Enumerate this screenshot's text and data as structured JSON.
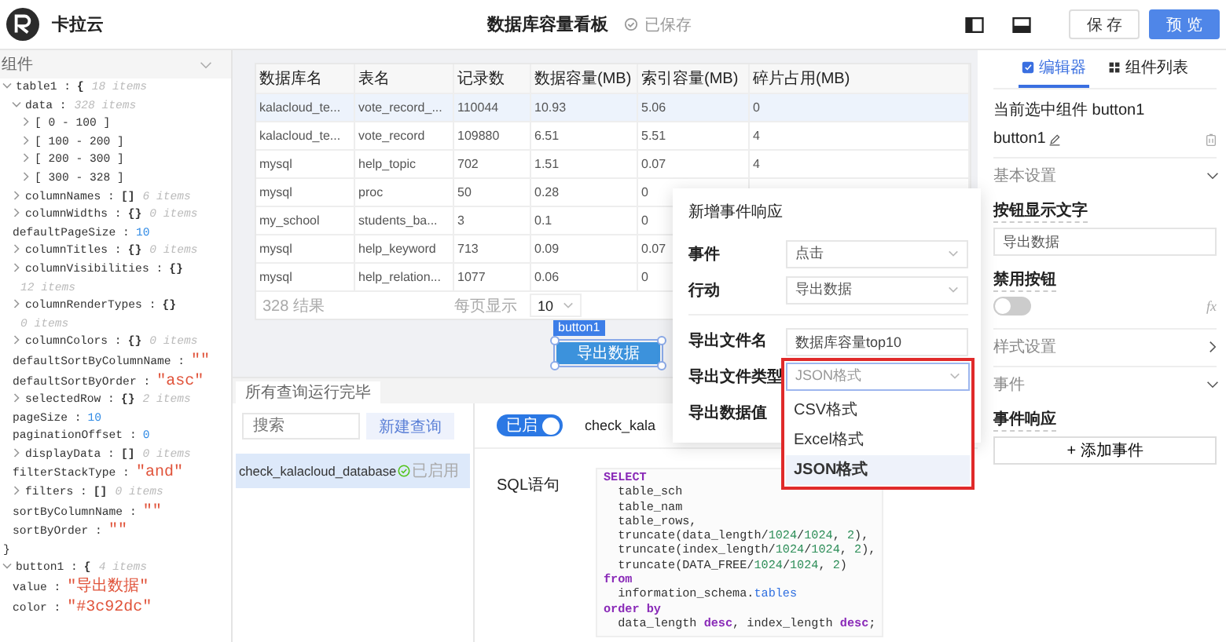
{
  "app": {
    "name": "卡拉云"
  },
  "header": {
    "title": "数据库容量看板",
    "save_status": "已保存",
    "buttons": [
      {
        "label": "保 存",
        "kind": "default"
      },
      {
        "label": "预 览",
        "kind": "primary"
      }
    ]
  },
  "state_panel": {
    "title": "组件",
    "tree": [
      {
        "key": "table1 :",
        "value": "{",
        "kind": "brace",
        "count": "18 items",
        "expanded": true,
        "close": "}",
        "children": [
          {
            "key": "data :",
            "count": "328 items",
            "expanded": true,
            "children": [
              {
                "key": "[ 0 - 100 ]",
                "expanded": false
              },
              {
                "key": "[ 100 - 200 ]",
                "expanded": false
              },
              {
                "key": "[ 200 - 300 ]",
                "expanded": false
              },
              {
                "key": "[ 300 - 328 ]",
                "expanded": false
              }
            ]
          },
          {
            "key": "columnNames :",
            "value": "[]",
            "kind": "brace",
            "count": "6 items",
            "expanded": false
          },
          {
            "key": "columnWidths :",
            "value": "{}",
            "kind": "brace",
            "count": "0 items",
            "expanded": false
          },
          {
            "key": "defaultPageSize :",
            "value": "10",
            "kind": "number"
          },
          {
            "key": "columnTitles :",
            "value": "{}",
            "kind": "brace",
            "count": "0 items",
            "expanded": false
          },
          {
            "key": "columnVisibilities :",
            "value": "{}",
            "kind": "brace",
            "count": "12 items",
            "expanded": false
          },
          {
            "key": "columnRenderTypes :",
            "value": "{}",
            "kind": "brace",
            "count": "0 items",
            "expanded": false
          },
          {
            "key": "columnColors :",
            "value": "{}",
            "kind": "brace",
            "count": "0 items",
            "expanded": false
          },
          {
            "key": "defaultSortByColumnName :",
            "value": "\"\"",
            "kind": "string"
          },
          {
            "key": "defaultSortByOrder :",
            "value": "\"asc\"",
            "kind": "string"
          },
          {
            "key": "selectedRow :",
            "value": "{}",
            "kind": "brace",
            "count": "2 items",
            "expanded": false
          },
          {
            "key": "pageSize :",
            "value": "10",
            "kind": "number"
          },
          {
            "key": "paginationOffset :",
            "value": "0",
            "kind": "number"
          },
          {
            "key": "displayData :",
            "value": "[]",
            "kind": "brace",
            "count": "0 items",
            "expanded": false
          },
          {
            "key": "filterStackType :",
            "value": "\"and\"",
            "kind": "string"
          },
          {
            "key": "filters :",
            "value": "[]",
            "kind": "brace",
            "count": "0 items",
            "expanded": false
          },
          {
            "key": "sortByColumnName :",
            "value": "\"\"",
            "kind": "string"
          },
          {
            "key": "sortByOrder :",
            "value": "\"\"",
            "kind": "string"
          }
        ]
      },
      {
        "key": "button1 :",
        "value": "{",
        "kind": "brace",
        "count": "4 items",
        "expanded": true,
        "children": [
          {
            "key": "value :",
            "value": "\"导出数据\"",
            "kind": "string"
          },
          {
            "key": "color :",
            "value": "\"#3c92dc\"",
            "kind": "string"
          }
        ]
      }
    ]
  },
  "table": {
    "columns": [
      "数据库名",
      "表名",
      "记录数",
      "数据容量(MB)",
      "索引容量(MB)",
      "碎片占用(MB)"
    ],
    "rows": [
      {
        "cells": [
          "kalacloud_te...",
          "vote_record_...",
          "110044",
          "10.93",
          "5.06",
          "0"
        ],
        "selected": true
      },
      {
        "cells": [
          "kalacloud_te...",
          "vote_record",
          "109880",
          "6.51",
          "5.51",
          "4"
        ],
        "selected": false
      },
      {
        "cells": [
          "mysql",
          "help_topic",
          "702",
          "1.51",
          "0.07",
          "4"
        ],
        "selected": false
      },
      {
        "cells": [
          "mysql",
          "proc",
          "50",
          "0.28",
          "0"
        ],
        "selected": false
      },
      {
        "cells": [
          "my_school",
          "students_ba...",
          "3",
          "0.1",
          "0"
        ],
        "selected": false
      },
      {
        "cells": [
          "mysql",
          "help_keyword",
          "713",
          "0.09",
          "0.07"
        ],
        "selected": false
      },
      {
        "cells": [
          "mysql",
          "help_relation...",
          "1077",
          "0.06",
          "0"
        ],
        "selected": false
      }
    ],
    "footer": {
      "count": "328 结果",
      "page_size_label": "每页显示",
      "page_size": "10"
    }
  },
  "selected_component": {
    "tag": "button1",
    "button_label": "导出数据"
  },
  "queries": {
    "status_tab": "所有查询运行完毕",
    "search": {
      "placeholder": "搜索"
    },
    "new_button": "新建查询",
    "items": [
      {
        "name": "check_kalacloud_database",
        "status": "已启用",
        "selected": true
      }
    ],
    "toggle": {
      "label": "已启",
      "on": true
    },
    "query_name": "check_kala",
    "sql_label": "SQL语句",
    "sql_lines": [
      [
        {
          "text": "SELECT",
          "kind": "keyword"
        }
      ],
      [
        {
          "text": "  table_sch",
          "kind": "plain"
        }
      ],
      [
        {
          "text": "  table_nam",
          "kind": "plain"
        }
      ],
      [
        {
          "text": "  table_rows,",
          "kind": "plain"
        }
      ],
      [
        {
          "text": "  truncate(data_length/",
          "kind": "plain"
        },
        {
          "text": "1024",
          "kind": "number"
        },
        {
          "text": "/",
          "kind": "plain"
        },
        {
          "text": "1024",
          "kind": "number"
        },
        {
          "text": ", ",
          "kind": "plain"
        },
        {
          "text": "2",
          "kind": "number"
        },
        {
          "text": "),",
          "kind": "plain"
        }
      ],
      [
        {
          "text": "  truncate(index_length/",
          "kind": "plain"
        },
        {
          "text": "1024",
          "kind": "number"
        },
        {
          "text": "/",
          "kind": "plain"
        },
        {
          "text": "1024",
          "kind": "number"
        },
        {
          "text": ", ",
          "kind": "plain"
        },
        {
          "text": "2",
          "kind": "number"
        },
        {
          "text": "),",
          "kind": "plain"
        }
      ],
      [
        {
          "text": "  truncate(DATA_FREE/",
          "kind": "plain"
        },
        {
          "text": "1024",
          "kind": "number"
        },
        {
          "text": "/",
          "kind": "plain"
        },
        {
          "text": "1024",
          "kind": "number"
        },
        {
          "text": ", ",
          "kind": "plain"
        },
        {
          "text": "2",
          "kind": "number"
        },
        {
          "text": ")",
          "kind": "plain"
        }
      ],
      [
        {
          "text": "from",
          "kind": "keyword"
        }
      ],
      [
        {
          "text": "  information_schema.",
          "kind": "plain"
        },
        {
          "text": "tables",
          "kind": "builtin"
        }
      ],
      [
        {
          "text": "order by",
          "kind": "keyword"
        }
      ],
      [
        {
          "text": "  data_length ",
          "kind": "plain"
        },
        {
          "text": "desc",
          "kind": "keyword"
        },
        {
          "text": ", index_length ",
          "kind": "plain"
        },
        {
          "text": "desc",
          "kind": "keyword"
        },
        {
          "text": ";",
          "kind": "plain"
        }
      ]
    ]
  },
  "event_dialog": {
    "title": "新增事件响应",
    "event_fields": [
      {
        "label": "事件",
        "value": "点击",
        "kind": "select"
      },
      {
        "label": "行动",
        "value": "导出数据",
        "kind": "select"
      }
    ],
    "export_fields": [
      {
        "label": "导出文件名",
        "value": "数据库容量top10",
        "kind": "input"
      },
      {
        "label": "导出文件类型",
        "value": "JSON格式",
        "kind": "open-select"
      },
      {
        "label": "导出数据值",
        "kind": "none"
      }
    ],
    "options": [
      {
        "label": "CSV格式",
        "selected": false
      },
      {
        "label": "Excel格式",
        "selected": false
      },
      {
        "label": "JSON格式",
        "selected": true
      }
    ]
  },
  "inspector": {
    "tabs": [
      {
        "label": "编辑器",
        "selected": true
      },
      {
        "label": "组件列表",
        "selected": false
      }
    ],
    "current_label": "当前选中组件 button1",
    "component_name": "button1",
    "sections": [
      {
        "title": "基本设置",
        "expanded": true,
        "kind": "basic"
      },
      {
        "title": "样式设置",
        "expanded": false,
        "kind": "style"
      },
      {
        "title": "事件",
        "expanded": true,
        "kind": "events"
      }
    ],
    "text_label": "按钮显示文字",
    "text_value": "导出数据",
    "disable_label": "禁用按钮",
    "disable_on": false,
    "fx": "fx",
    "events_label": "事件响应",
    "add_event": "+ 添加事件"
  }
}
